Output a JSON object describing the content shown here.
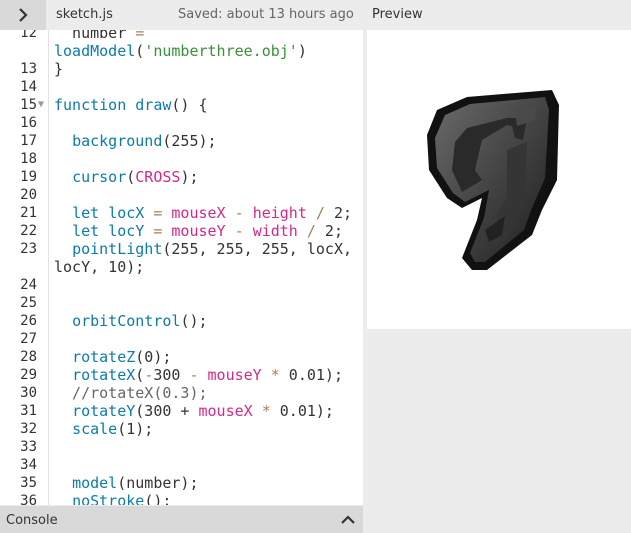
{
  "header": {
    "file_name": "sketch.js",
    "saved_status": "Saved: about 13 hours ago",
    "preview_label": "Preview"
  },
  "console": {
    "label": "Console"
  },
  "editor": {
    "lines": [
      {
        "n": "12",
        "text": "  number ="
      },
      {
        "n": "",
        "text": "loadModel('numberthree.obj')"
      },
      {
        "n": "13",
        "text": "}"
      },
      {
        "n": "14",
        "text": ""
      },
      {
        "n": "15",
        "text": "function draw() {"
      },
      {
        "n": "16",
        "text": ""
      },
      {
        "n": "17",
        "text": "  background(255);"
      },
      {
        "n": "18",
        "text": ""
      },
      {
        "n": "19",
        "text": "  cursor(CROSS);"
      },
      {
        "n": "20",
        "text": ""
      },
      {
        "n": "21",
        "text": "  let locX = mouseX - height / 2;"
      },
      {
        "n": "22",
        "text": "  let locY = mouseY - width / 2;"
      },
      {
        "n": "23",
        "text": "  pointLight(255, 255, 255, locX,"
      },
      {
        "n": "",
        "text": "locY, 10);"
      },
      {
        "n": "24",
        "text": ""
      },
      {
        "n": "25",
        "text": ""
      },
      {
        "n": "26",
        "text": "  orbitControl();"
      },
      {
        "n": "27",
        "text": ""
      },
      {
        "n": "28",
        "text": "  rotateZ(0);"
      },
      {
        "n": "29",
        "text": "  rotateX(-300 - mouseY * 0.01);"
      },
      {
        "n": "30",
        "text": "  //rotateX(0.3);"
      },
      {
        "n": "31",
        "text": "  rotateY(300 + mouseX * 0.01);"
      },
      {
        "n": "32",
        "text": "  scale(1);"
      },
      {
        "n": "33",
        "text": ""
      },
      {
        "n": "34",
        "text": ""
      },
      {
        "n": "35",
        "text": "  model(number);"
      },
      {
        "n": "36",
        "text": "  noStroke();"
      }
    ]
  }
}
